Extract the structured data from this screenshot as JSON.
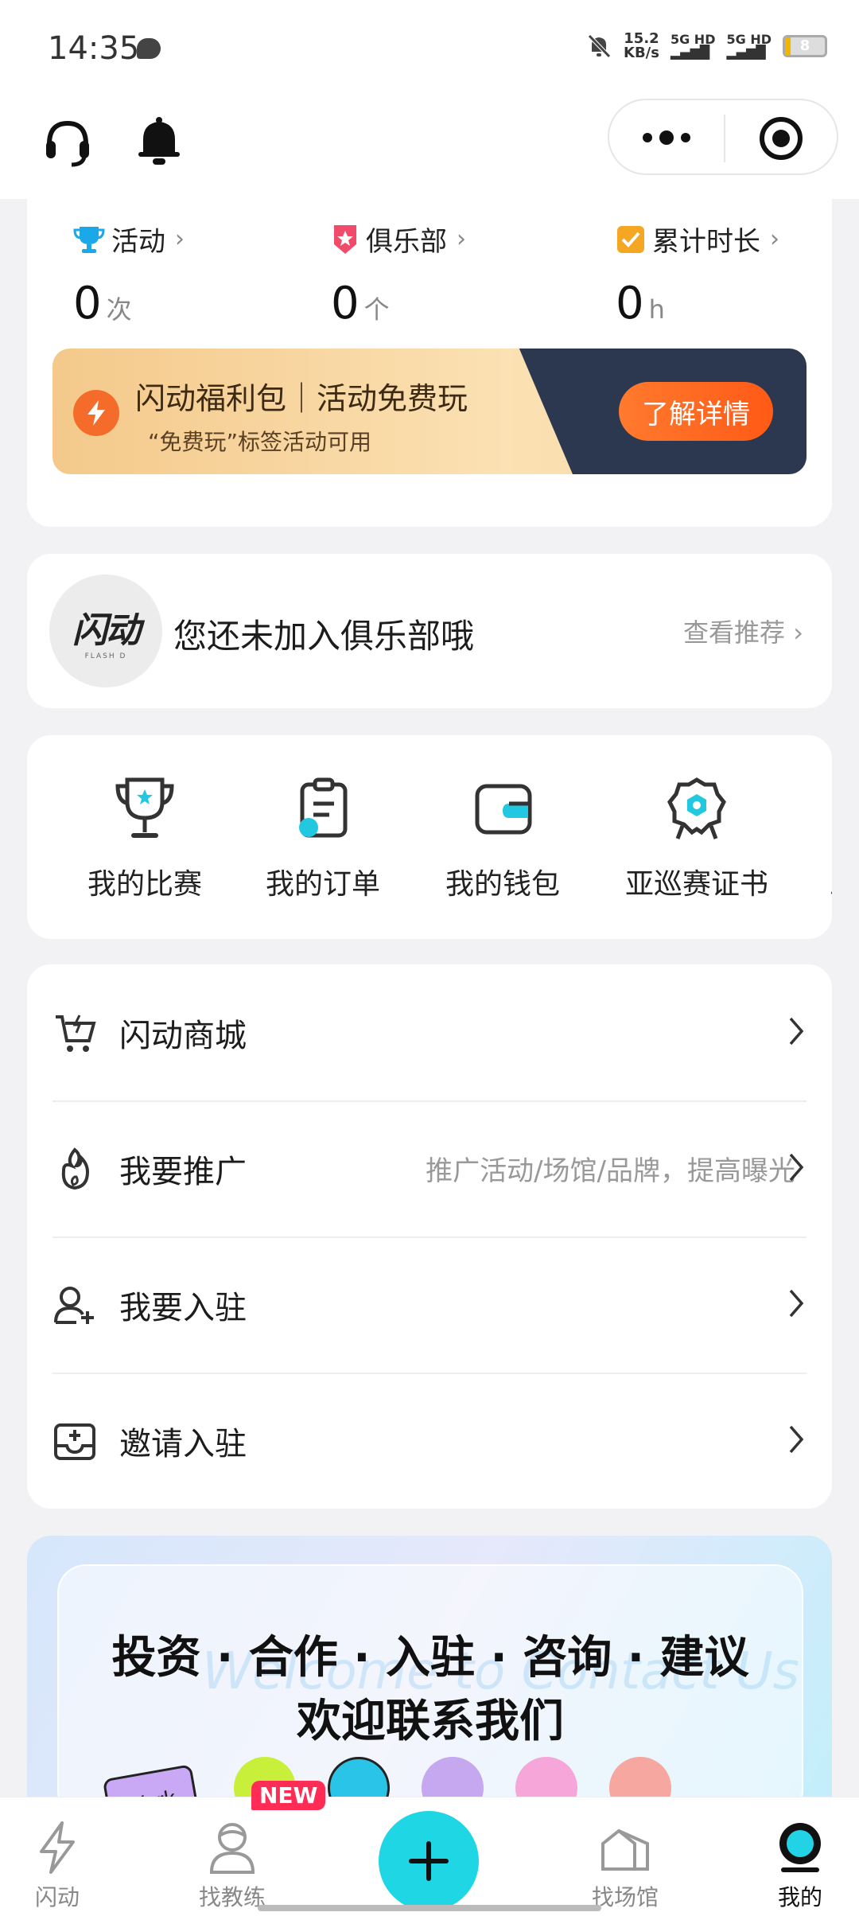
{
  "status_bar": {
    "time": "14:35",
    "speed": "15.2",
    "speed_unit": "KB/s",
    "sim1": "5G HD",
    "sim2": "5G HD",
    "battery": "8"
  },
  "stats": {
    "items": [
      {
        "label": "活动",
        "value": "0",
        "unit": "次",
        "icon": "trophy-icon"
      },
      {
        "label": "俱乐部",
        "value": "0",
        "unit": "个",
        "icon": "club-badge-icon"
      },
      {
        "label": "累计时长",
        "value": "0",
        "unit": "h",
        "icon": "checkbox-icon"
      }
    ]
  },
  "banner": {
    "title": "闪动福利包｜活动免费玩",
    "subtitle": "“免费玩”标签活动可用",
    "button": "了解详情"
  },
  "club": {
    "logo_text": "闪动",
    "logo_sub": "FLASH D",
    "text": "您还未加入俱乐部哦",
    "link": "查看推荐"
  },
  "tools": [
    {
      "label": "我的比赛",
      "icon": "trophy-cup-icon"
    },
    {
      "label": "我的订单",
      "icon": "order-clipboard-icon"
    },
    {
      "label": "我的钱包",
      "icon": "wallet-icon"
    },
    {
      "label": "亚巡赛证书",
      "icon": "certificate-badge-icon"
    },
    {
      "label": "AI运",
      "icon": "ai-icon"
    }
  ],
  "menu": [
    {
      "label": "闪动商城",
      "hint": "",
      "icon": "cart-icon"
    },
    {
      "label": "我要推广",
      "hint": "推广活动/场馆/品牌，提高曝光",
      "icon": "flame-icon"
    },
    {
      "label": "我要入驻",
      "hint": "",
      "icon": "add-user-icon"
    },
    {
      "label": "邀请入驻",
      "hint": "",
      "icon": "invite-inbox-icon"
    }
  ],
  "contact": {
    "line1": "投资 · 合作 · 入驻 · 咨询 · 建议",
    "line2": "欢迎联系我们",
    "watermark": "Welcome to Contact Us",
    "tag": "Work"
  },
  "tabbar": {
    "items": [
      {
        "label": "闪动"
      },
      {
        "label": "找教练"
      },
      {
        "label": "找场馆"
      },
      {
        "label": "我的"
      }
    ],
    "new_badge": "NEW"
  },
  "colors": {
    "accent": "#1ed6e4",
    "banner_button": "#ff5a16",
    "banner_dark": "#2b3850"
  }
}
